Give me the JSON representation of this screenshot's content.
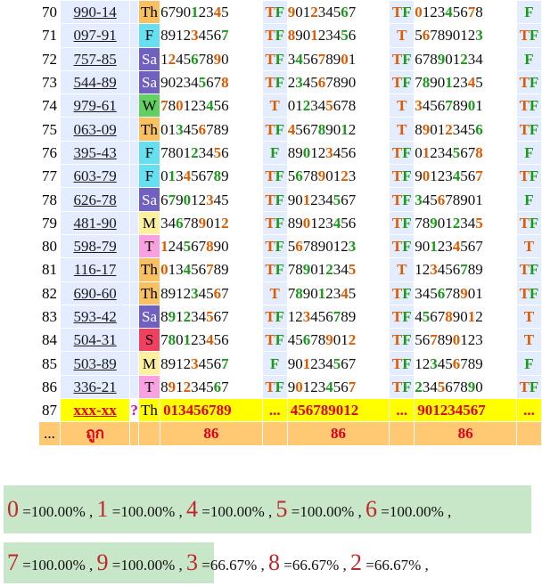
{
  "rows": [
    {
      "idx": "70",
      "code": "990-14",
      "day": "Th",
      "dayColor": "#f8c060",
      "a": "679012345",
      "ar": "TF",
      "b": "901234567",
      "br": "TF",
      "c": "012345678",
      "cr": "F"
    },
    {
      "idx": "71",
      "code": "097-91",
      "day": "F",
      "dayColor": "#66e0f0",
      "a": "891234567",
      "ar": "TF",
      "b": "890123456",
      "br": "T",
      "c": "567890123",
      "cr": "TF"
    },
    {
      "idx": "72",
      "code": "757-85",
      "day": "Sa",
      "dayColor": "#7060c0",
      "a": "124567890",
      "ar": "TF",
      "b": "345678901",
      "br": "TF",
      "c": "678901234",
      "cr": "F"
    },
    {
      "idx": "73",
      "code": "544-89",
      "day": "Sa",
      "dayColor": "#7060c0",
      "a": "902345678",
      "ar": "TF",
      "b": "234567890",
      "br": "TF",
      "c": "789012345",
      "cr": "TF"
    },
    {
      "idx": "74",
      "code": "979-61",
      "day": "W",
      "dayColor": "#60d060",
      "a": "780123456",
      "ar": "T",
      "b": "012345678",
      "br": "T",
      "c": "345678901",
      "cr": "TF"
    },
    {
      "idx": "75",
      "code": "063-09",
      "day": "Th",
      "dayColor": "#f8c060",
      "a": "013456789",
      "ar": "TF",
      "b": "456789012",
      "br": "T",
      "c": "890123456",
      "cr": "TF"
    },
    {
      "idx": "76",
      "code": "395-43",
      "day": "F",
      "dayColor": "#66e0f0",
      "a": "780123456",
      "ar": "F",
      "b": "890123456",
      "br": "TF",
      "c": "012345678",
      "cr": "F"
    },
    {
      "idx": "77",
      "code": "603-79",
      "day": "F",
      "dayColor": "#66e0f0",
      "a": "013456789",
      "ar": "TF",
      "b": "567890123",
      "br": "TF",
      "c": "901234567",
      "cr": "TF"
    },
    {
      "idx": "78",
      "code": "626-78",
      "day": "Sa",
      "dayColor": "#7060c0",
      "a": "679012345",
      "ar": "TF",
      "b": "901234567",
      "br": "TF",
      "c": "345678901",
      "cr": "F"
    },
    {
      "idx": "79",
      "code": "481-90",
      "day": "M",
      "dayColor": "#fff0a0",
      "a": "346789012",
      "ar": "TF",
      "b": "890123456",
      "br": "TF",
      "c": "789012345",
      "cr": "TF"
    },
    {
      "idx": "80",
      "code": "598-79",
      "day": "T",
      "dayColor": "#f8a0e0",
      "a": "124567890",
      "ar": "TF",
      "b": "567890123",
      "br": "TF",
      "c": "901234567",
      "cr": "T"
    },
    {
      "idx": "81",
      "code": "116-17",
      "day": "Th",
      "dayColor": "#f8c060",
      "a": "013456789",
      "ar": "TF",
      "b": "789012345",
      "br": "T",
      "c": "123456789",
      "cr": "TF"
    },
    {
      "idx": "82",
      "code": "690-60",
      "day": "Th",
      "dayColor": "#f8c060",
      "a": "891234567",
      "ar": "T",
      "b": "789012345",
      "br": "TF",
      "c": "345678901",
      "cr": "TF"
    },
    {
      "idx": "83",
      "code": "593-42",
      "day": "Sa",
      "dayColor": "#7060c0",
      "a": "891234567",
      "ar": "TF",
      "b": "123456789",
      "br": "TF",
      "c": "456789012",
      "cr": "T"
    },
    {
      "idx": "84",
      "code": "504-31",
      "day": "S",
      "dayColor": "#f04060",
      "a": "780123456",
      "ar": "TF",
      "b": "456789012",
      "br": "TF",
      "c": "567890123",
      "cr": "T"
    },
    {
      "idx": "85",
      "code": "503-89",
      "day": "M",
      "dayColor": "#fff0a0",
      "a": "891234567",
      "ar": "F",
      "b": "901234567",
      "br": "TF",
      "c": "123456789",
      "cr": "F"
    },
    {
      "idx": "86",
      "code": "336-21",
      "day": "T",
      "dayColor": "#f8a0e0",
      "a": "891234567",
      "ar": "TF",
      "b": "901234567",
      "br": "TF",
      "c": "234567890",
      "cr": "TF"
    }
  ],
  "prediction": {
    "idx": "87",
    "code": "xxx-xx",
    "mark": "?",
    "day": "Th",
    "a": "013456789",
    "ar": "...",
    "b": "456789012",
    "br": "...",
    "c": "901234567",
    "cr": "..."
  },
  "footer": {
    "idx": "...",
    "label": "ถูก",
    "a": "86",
    "b": "86",
    "c": "86"
  },
  "stats_line1": [
    {
      "digit": "0",
      "pct": "=100.00%",
      "sep": ","
    },
    {
      "digit": "1",
      "pct": "=100.00%",
      "sep": ","
    },
    {
      "digit": "4",
      "pct": "=100.00%",
      "sep": ","
    },
    {
      "digit": "5",
      "pct": "=100.00%",
      "sep": ","
    },
    {
      "digit": "6",
      "pct": "=100.00%",
      "sep": ","
    }
  ],
  "stats_line2": [
    {
      "digit": "7",
      "pct": "=100.00%",
      "sep": ","
    },
    {
      "digit": "9",
      "pct": "=100.00%",
      "sep": ","
    },
    {
      "digit": "3",
      "pct": "=66.67%",
      "sep": ","
    },
    {
      "digit": "8",
      "pct": "=66.67%",
      "sep": ","
    },
    {
      "digit": "2",
      "pct": "=66.67%",
      "sep": ","
    }
  ],
  "colors": {
    "green": "#1a9a1a",
    "orange": "#e05a00",
    "band": "#c8e6c8",
    "prediction": "#ffff00",
    "footer": "#ffc873"
  }
}
